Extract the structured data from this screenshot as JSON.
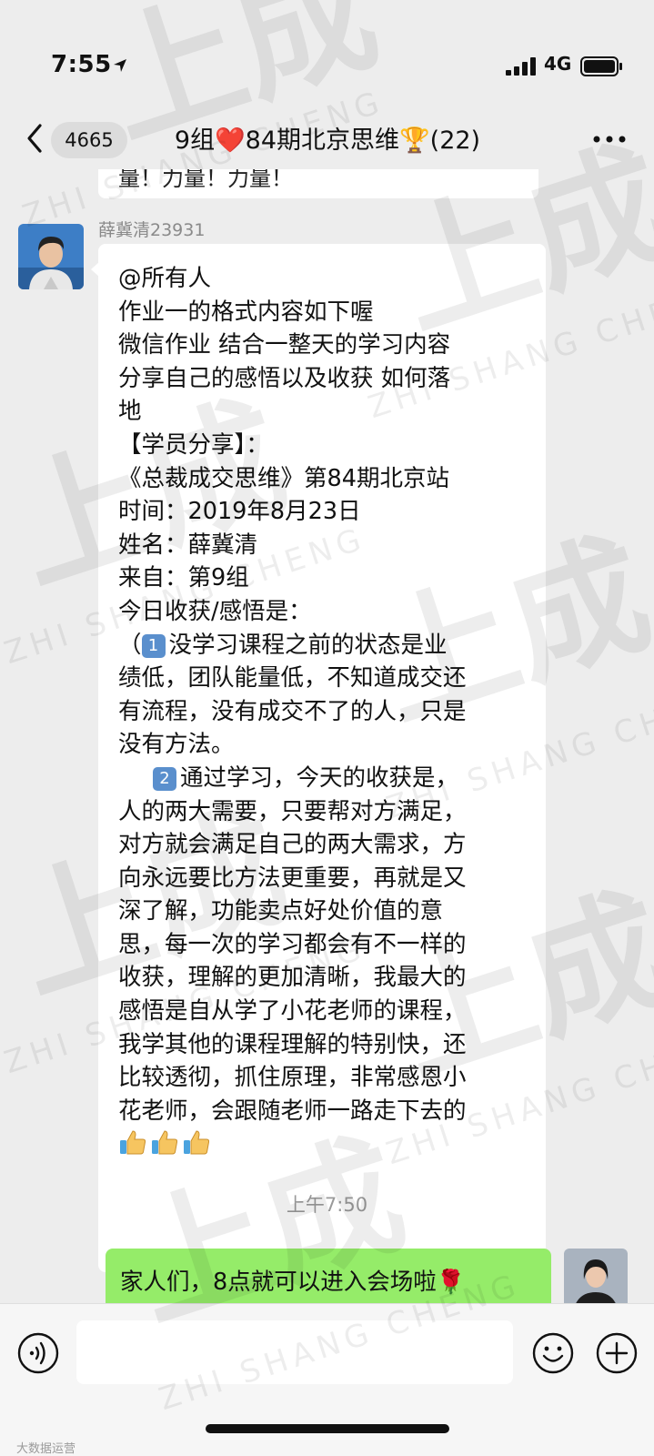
{
  "status_bar": {
    "time": "7:55",
    "location_icon": "location-arrow-icon",
    "signal_icon": "signal-bars-icon",
    "network": "4G",
    "battery_icon": "battery-icon"
  },
  "nav": {
    "back_icon": "chevron-left-icon",
    "unread_count": "4665",
    "title": "9组❤️84期北京思维🏆(22)",
    "more_icon": "more-dots-icon"
  },
  "chat": {
    "previous_message_fragment": "量！力量！力量！",
    "sender_name": "薛冀清23931",
    "message_lines": [
      "@所有人",
      "作业一的格式内容如下喔",
      "微信作业 结合一整天的学习内容",
      "分享自己的感悟以及收获 如何落",
      "地",
      "【学员分享】：",
      "《总裁成交思维》第84期北京站",
      "时间：2019年8月23日",
      "姓名：薛冀清",
      "来自：第9组",
      "今日收获/感悟是：",
      "没学习课程之前的状态是业",
      "绩低，团队能量低，不知道成交还",
      "有流程，没有成交不了的人，只是",
      "没有方法。",
      "通过学习，今天的收获是，",
      "人的两大需要，只要帮对方满足，",
      "对方就会满足自己的两大需求，方",
      "向永远要比方法更重要，再就是又",
      "深了解，功能卖点好处价值的意",
      "思，每一次的学习都会有不一样的",
      "收获，理解的更加清晰，我最大的",
      "感悟是自从学了小花老师的课程，",
      "我学其他的课程理解的特别快，还",
      "比较透彻，抓住原理，非常感恩小",
      "花老师，会跟随老师一路走下去的"
    ],
    "item_prefix_1": "（",
    "badge_1": "1",
    "badge_2": "2",
    "thumbs_icon": "thumbs-up-icon",
    "timestamp": "上午7:50",
    "my_message": "家人们，8点就可以进入会场啦🌹"
  },
  "input_bar": {
    "voice_icon": "voice-input-icon",
    "placeholder": "",
    "emoji_icon": "emoji-icon",
    "plus_icon": "plus-circle-icon",
    "credit": "大数据运营"
  },
  "watermark": {
    "brand": "上成",
    "brand_pinyin": "ZHI SHANG CHENG"
  },
  "colors": {
    "background": "#ededed",
    "incoming_bubble": "#ffffff",
    "outgoing_bubble": "#95ec69",
    "badge_blue": "#5a8fcd"
  }
}
